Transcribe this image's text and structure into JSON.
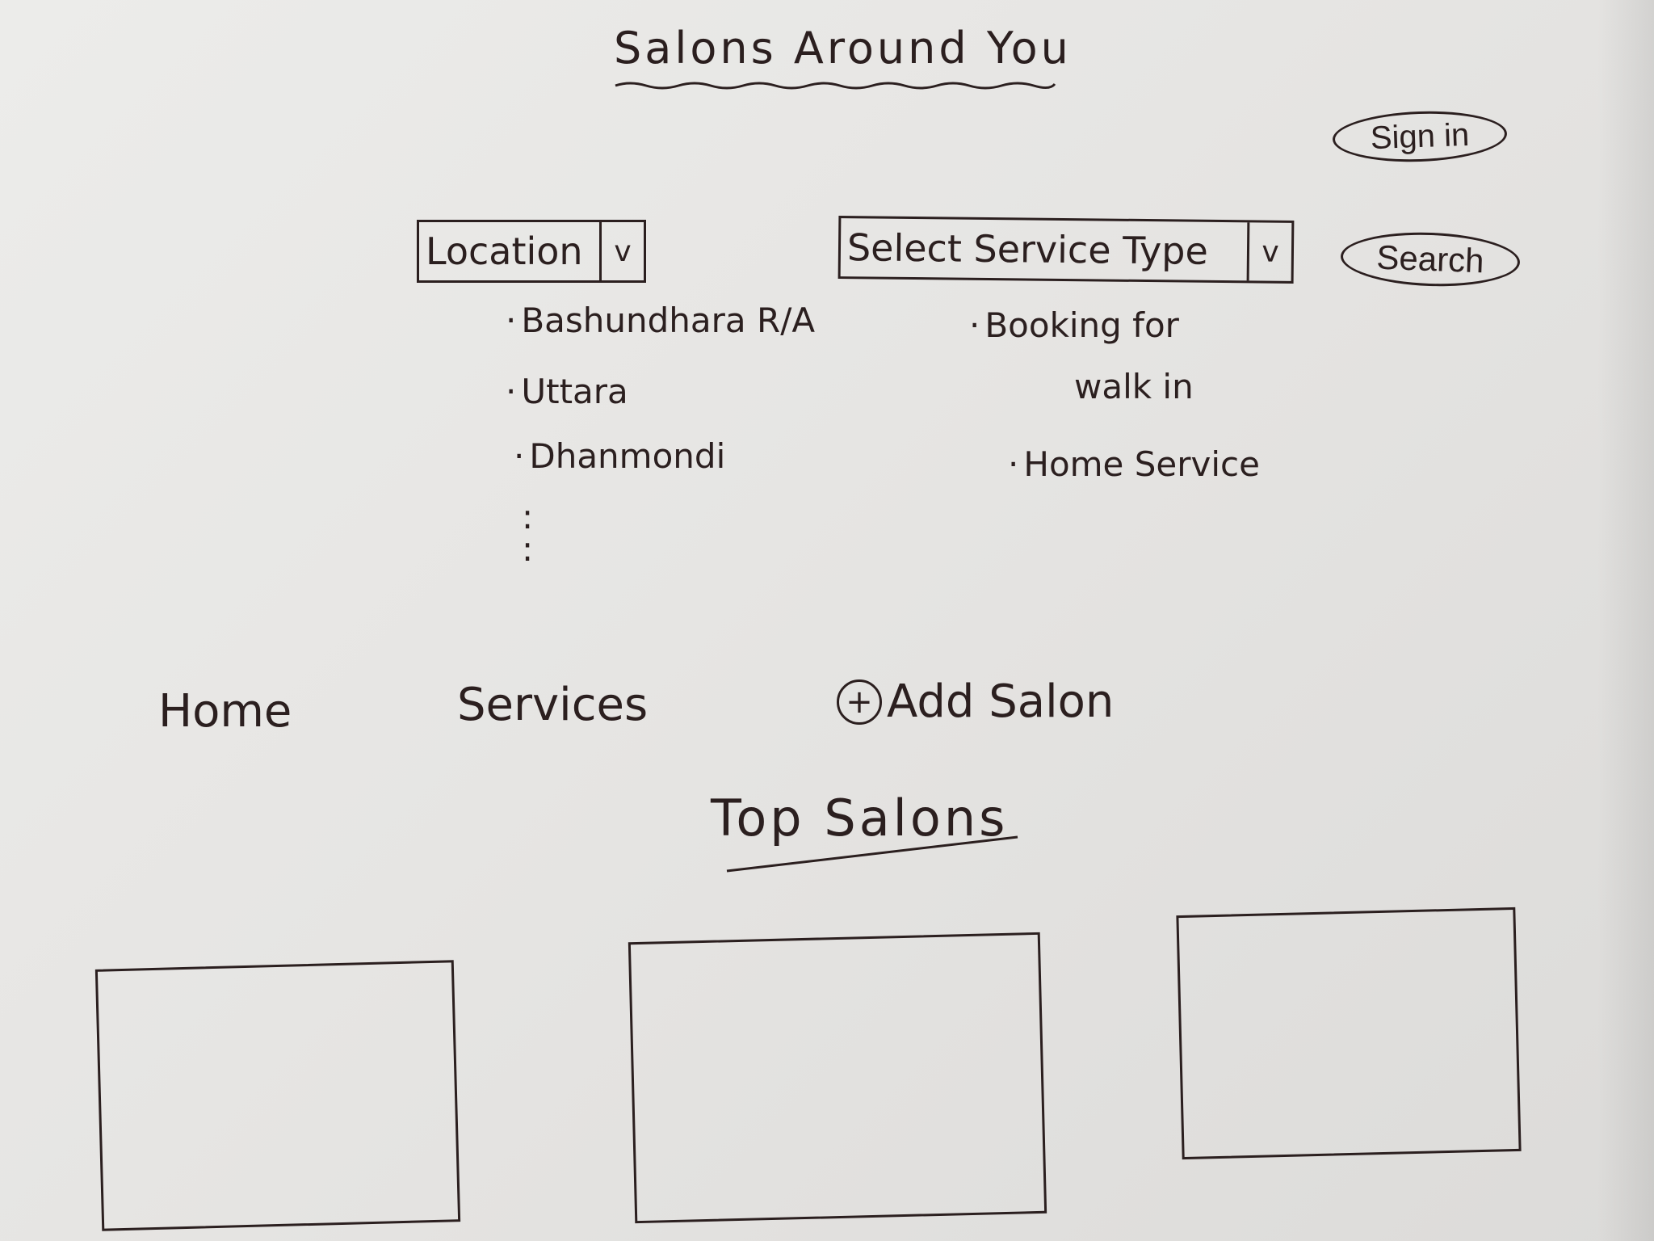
{
  "header": {
    "title": "Salons Around You",
    "sign_in_label": "Sign in"
  },
  "search_bar": {
    "location_label": "Location",
    "service_type_label": "Select Service Type",
    "dropdown_arrow": "v",
    "search_label": "Search"
  },
  "location_options": {
    "items": [
      "Bashundhara R/A",
      "Uttara",
      "Dhanmondi"
    ],
    "more": ":\n:"
  },
  "service_options": {
    "items": [
      "Booking for",
      "walk in",
      "Home Service"
    ]
  },
  "nav": {
    "home": "Home",
    "services": "Services",
    "add_salon": "Add Salon",
    "add_icon": "+"
  },
  "top_salons": {
    "title": "Top Salons",
    "cards": [
      "",
      "",
      ""
    ]
  },
  "colors": {
    "paper": "#e8e7e5",
    "ink": "#2b1f1f"
  }
}
